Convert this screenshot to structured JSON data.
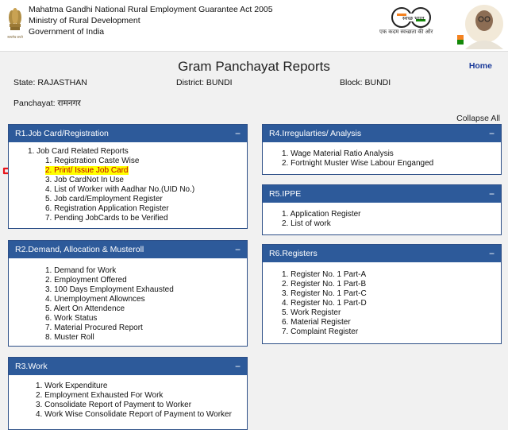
{
  "header": {
    "line1": "Mahatma Gandhi National Rural Employment Guarantee Act 2005",
    "line2": "Ministry of Rural Development",
    "line3": "Government of India",
    "emblem_motto": "सत्यमेव जयते",
    "swachh_word1": "स्वच्छ",
    "swachh_word2": "भारत",
    "swachh_tagline": "एक कदम स्वच्छता की ओर"
  },
  "page": {
    "title": "Gram Panchayat Reports",
    "home": "Home",
    "state": "State: RAJASTHAN",
    "district": "District: BUNDI",
    "block": "Block: BUNDI",
    "panchayat": "Panchayat: रामनगर",
    "collapse_all": "Collapse All"
  },
  "icons": {
    "toggle": "−",
    "arrow_color": "#e8141b",
    "header_bg": "#2d5a9a"
  },
  "panels": {
    "r1": {
      "title": "R1.Job Card/Registration",
      "group": "1. Job Card Related Reports",
      "items": [
        "1. Registration Caste Wise",
        "2. Print/ Issue Job Card",
        "3. Job CardNot In Use",
        "4. List of Worker with Aadhar No.(UID No.)",
        "5. Job card/Employment Register",
        "6. Registration Application Register",
        "7. Pending JobCards to be Verified"
      ]
    },
    "r2": {
      "title": "R2.Demand, Allocation & Musteroll",
      "items": [
        "1. Demand for Work",
        "2. Employment Offered",
        "3. 100 Days Employment Exhausted",
        "4. Unemployment Allownces",
        "5. Alert On Attendence",
        "6. Work Status",
        "7. Material Procured Report",
        "8. Muster Roll"
      ]
    },
    "r3": {
      "title": "R3.Work",
      "items": [
        "1. Work Expenditure",
        "2. Employment Exhausted For Work",
        "3. Consolidate Report of Payment to Worker",
        "4. Work Wise Consolidate Report of Payment to Worker"
      ]
    },
    "r4": {
      "title": "R4.Irregularties/ Analysis",
      "items": [
        "1. Wage Material Ratio Analysis",
        "2. Fortnight Muster Wise Labour Enganged"
      ]
    },
    "r5": {
      "title": "R5.IPPE",
      "items": [
        "1. Application Register",
        "2. List of work"
      ]
    },
    "r6": {
      "title": "R6.Registers",
      "items": [
        "1. Register No. 1 Part-A",
        "2. Register No. 1 Part-B",
        "3. Register No. 1 Part-C",
        "4. Register No. 1 Part-D",
        "5. Work Register",
        "6. Material Register",
        "7. Complaint Register"
      ]
    }
  }
}
